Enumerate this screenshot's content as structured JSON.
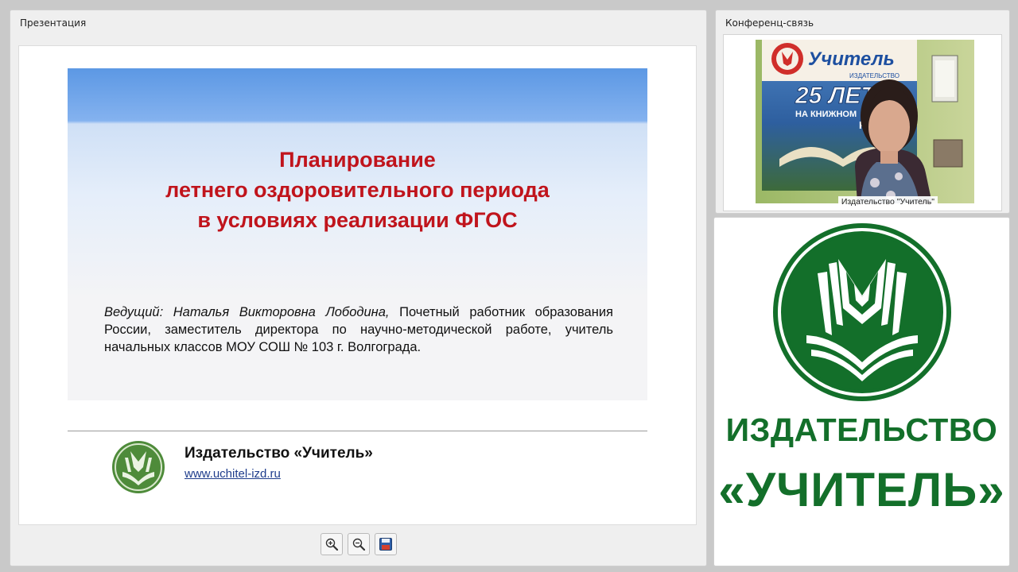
{
  "presentation": {
    "title": "Презентация",
    "slide": {
      "title_lines": [
        "Планирование",
        "летнего оздоровительного периода",
        "в условиях реализации ФГОС"
      ],
      "presenter_role": "Ведущий: Наталья Викторовна Лободина,",
      "presenter_desc": "Почетный работник образования России, заместитель директора по научно-методической работе, учитель начальных классов МОУ СОШ № 103 г. Волгограда.",
      "publisher_name": "Издательство «Учитель»",
      "publisher_url": "www.uchitel-izd.ru"
    },
    "toolbar": {
      "zoom_in_icon": "zoom-in-icon",
      "zoom_out_icon": "zoom-out-icon",
      "save_icon": "floppy-disk-icon"
    }
  },
  "conference": {
    "title": "Конференц-связь",
    "video_caption": "Издательство \"Учитель\"",
    "banner_text": "Учитель",
    "banner_subtext": "ИЗДАТЕЛЬСТВО",
    "banner_years": "25 ЛЕТ",
    "banner_tagline": "НА КНИЖНОМ",
    "banner_tagline2": "РОС"
  },
  "publisher_brand": {
    "line1": "ИЗДАТЕЛЬСТВО",
    "line2": "«УЧИТЕЛЬ»",
    "brand_color": "#136f2a"
  }
}
